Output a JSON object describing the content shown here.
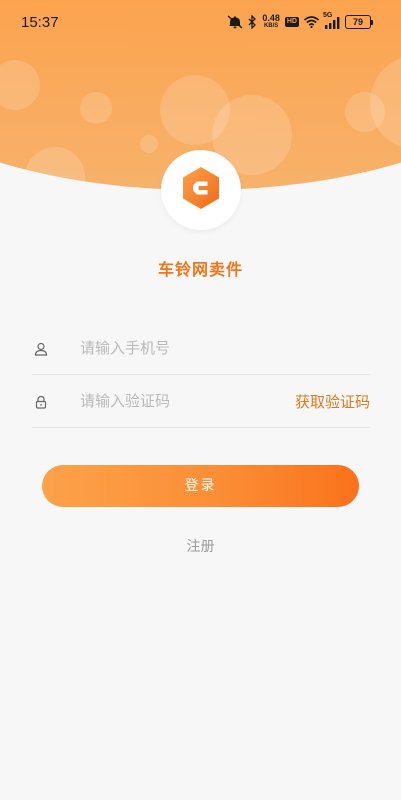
{
  "status_bar": {
    "time": "15:37",
    "net_speed_value": "0.48",
    "net_speed_unit": "KB/S",
    "hd_label": "HD",
    "network_label": "5G",
    "battery_level": "79"
  },
  "app": {
    "title": "车铃网卖件"
  },
  "form": {
    "phone_placeholder": "请输入手机号",
    "phone_value": "",
    "code_placeholder": "请输入验证码",
    "code_value": "",
    "get_code_label": "获取验证码"
  },
  "actions": {
    "login_label": "登录",
    "register_label": "注册"
  },
  "colors": {
    "brand": "#f2761a",
    "header_orange": "#ff9a3c",
    "button_start": "#fca24a",
    "button_end": "#fa721b"
  },
  "icons": {
    "logo": "hexagon-c-logo",
    "phone_row": "user-icon",
    "code_row": "lock-icon"
  }
}
